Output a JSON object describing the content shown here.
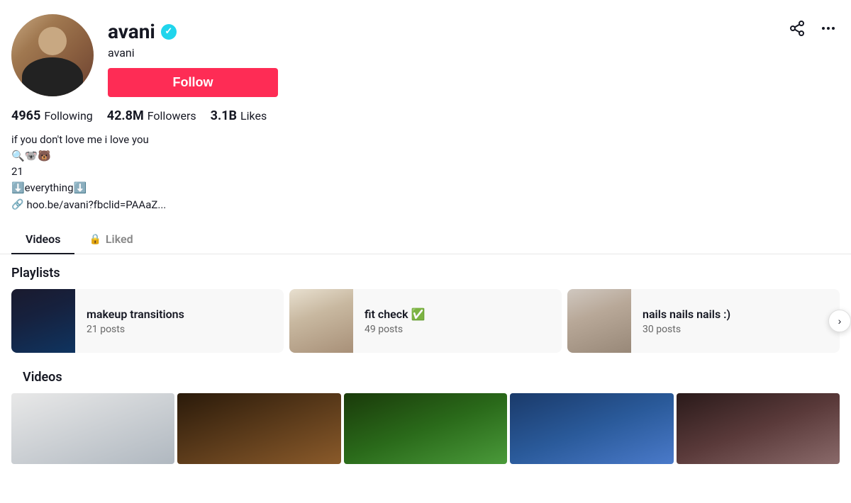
{
  "profile": {
    "username": "avani",
    "display_name": "avani",
    "verified": true,
    "follow_label": "Follow",
    "stats": {
      "following_count": "4965",
      "following_label": "Following",
      "followers_count": "42.8M",
      "followers_label": "Followers",
      "likes_count": "3.1B",
      "likes_label": "Likes"
    },
    "bio_lines": [
      "if you don't love me i love you",
      "🔍🐨🐻",
      "21",
      "⬇️everything⬇️"
    ],
    "link_text": "hoo.be/avani?fbclid=PAAaZ...",
    "link_icon": "🔗"
  },
  "tabs": [
    {
      "id": "videos",
      "label": "Videos",
      "active": true,
      "locked": false
    },
    {
      "id": "liked",
      "label": "Liked",
      "active": false,
      "locked": true
    }
  ],
  "playlists": {
    "section_title": "Playlists",
    "items": [
      {
        "id": "makeup-transitions",
        "name": "makeup transitions",
        "posts": "21 posts"
      },
      {
        "id": "fit-check",
        "name": "fit check ✅",
        "posts": "49 posts"
      },
      {
        "id": "nails-nails-nails",
        "name": "nails nails nails :)",
        "posts": "30 posts"
      }
    ]
  },
  "videos": {
    "section_title": "Videos"
  },
  "icons": {
    "share": "⬆",
    "more": "•••",
    "lock": "🔒",
    "chevron_right": "›"
  }
}
